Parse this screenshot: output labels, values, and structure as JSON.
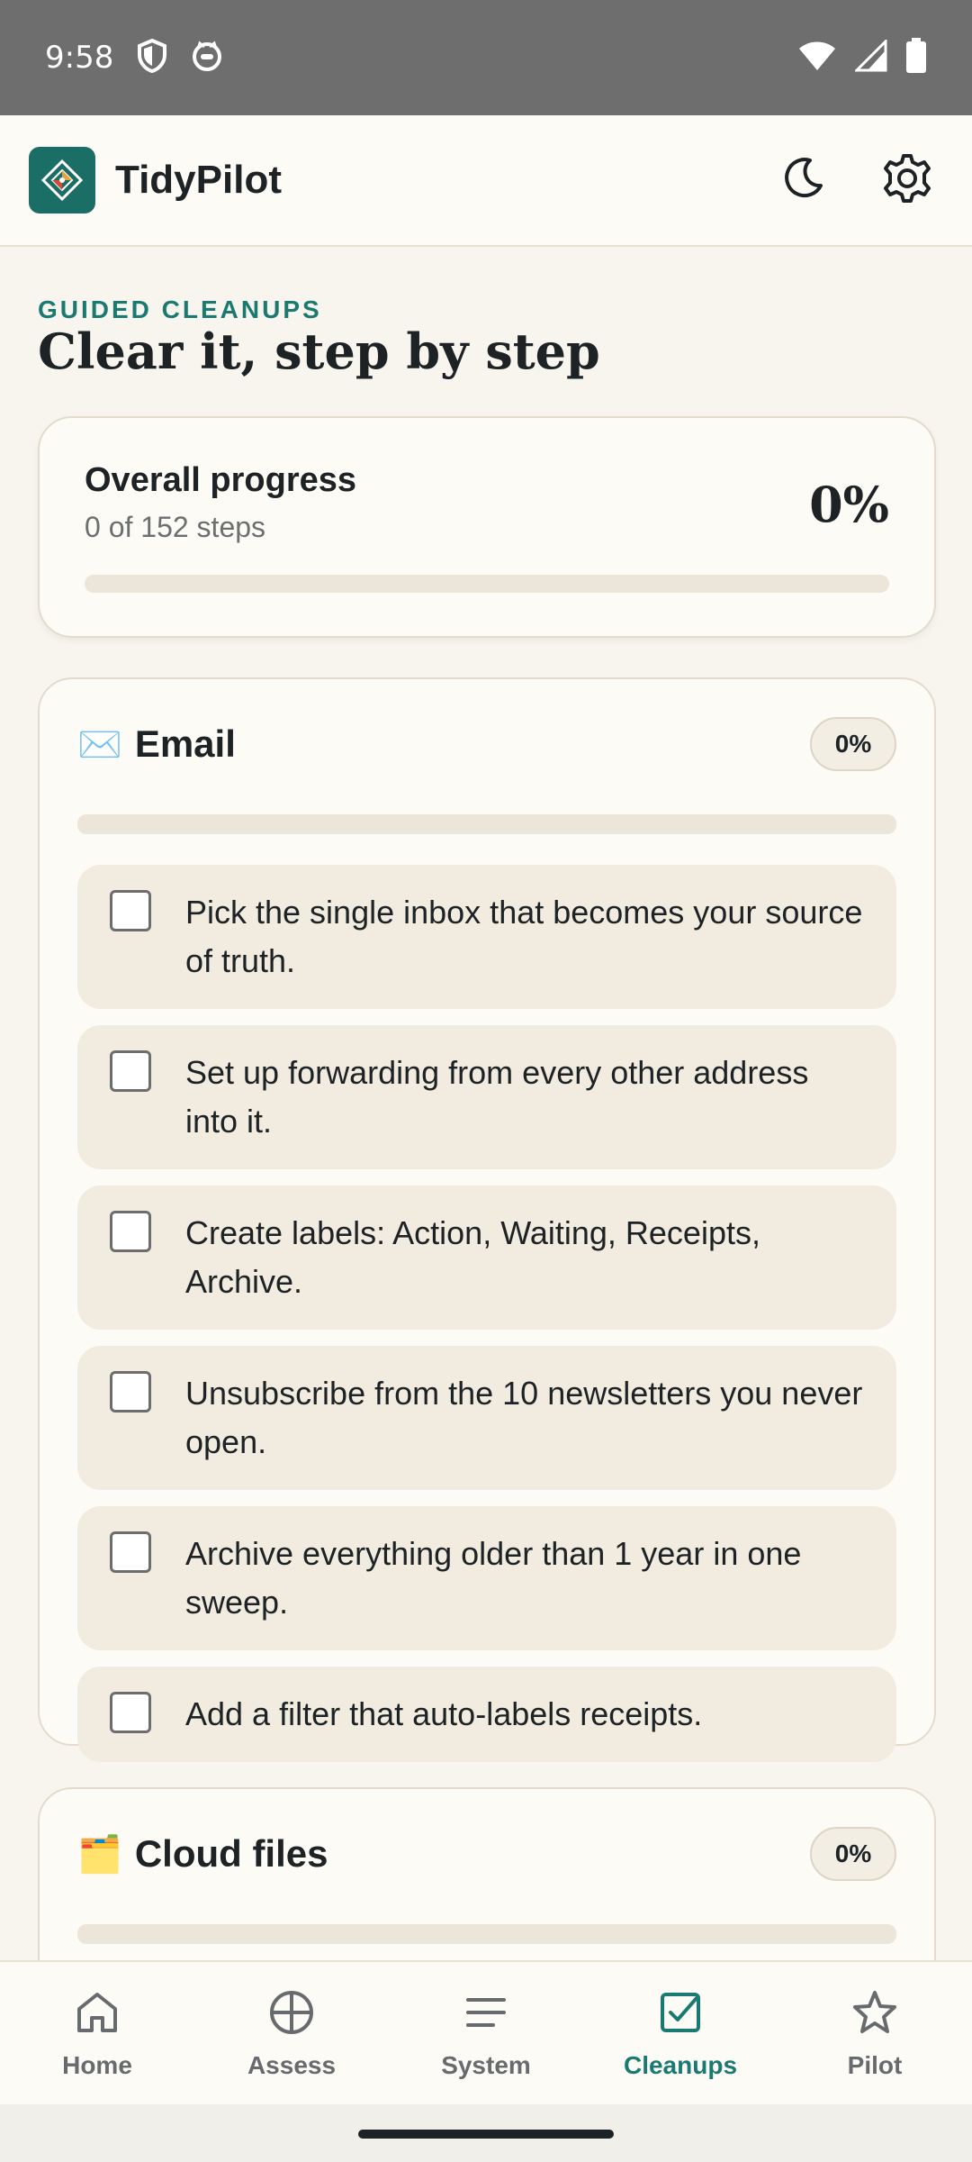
{
  "status_bar": {
    "time": "9:58"
  },
  "app": {
    "name": "TidyPilot"
  },
  "page": {
    "eyebrow": "GUIDED CLEANUPS",
    "title": "Clear it, step by step"
  },
  "overall": {
    "title": "Overall progress",
    "subtitle": "0 of 152 steps",
    "percent_label": "0%",
    "progress": 0
  },
  "sections": [
    {
      "icon": "envelope-icon",
      "emoji": "✉️",
      "name": "Email",
      "percent_label": "0%",
      "progress": 0,
      "steps": [
        {
          "text": "Pick the single inbox that becomes your source of truth.",
          "checked": false
        },
        {
          "text": "Set up forwarding from every other address into it.",
          "checked": false
        },
        {
          "text": "Create labels: Action, Waiting, Receipts, Archive.",
          "checked": false
        },
        {
          "text": "Unsubscribe from the 10 newsletters you never open.",
          "checked": false
        },
        {
          "text": "Archive everything older than 1 year in one sweep.",
          "checked": false
        },
        {
          "text": "Add a filter that auto-labels receipts.",
          "checked": false
        }
      ]
    },
    {
      "icon": "card-index-dividers-icon",
      "emoji": "🗂️",
      "name": "Cloud files",
      "percent_label": "0%",
      "progress": 0
    }
  ],
  "nav": [
    {
      "label": "Home",
      "icon": "home-icon",
      "active": false
    },
    {
      "label": "Assess",
      "icon": "assess-icon",
      "active": false
    },
    {
      "label": "System",
      "icon": "system-icon",
      "active": false
    },
    {
      "label": "Cleanups",
      "icon": "cleanups-icon",
      "active": true
    },
    {
      "label": "Pilot",
      "icon": "star-icon",
      "active": false
    }
  ],
  "colors": {
    "accent": "#1a7a72",
    "background": "#f8f5ee",
    "card": "#fdfbf6",
    "step_bg": "#f2ebe0"
  }
}
